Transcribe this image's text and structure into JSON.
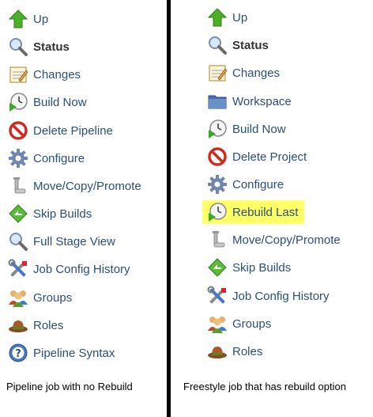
{
  "left_panel": {
    "items": [
      {
        "label": "Up",
        "icon": "up-arrow-icon",
        "bold": false
      },
      {
        "label": "Status",
        "icon": "magnifier-icon",
        "bold": true
      },
      {
        "label": "Changes",
        "icon": "notepad-icon",
        "bold": false
      },
      {
        "label": "Build Now",
        "icon": "clock-play-icon",
        "bold": false
      },
      {
        "label": "Delete Pipeline",
        "icon": "no-entry-icon",
        "bold": false
      },
      {
        "label": "Configure",
        "icon": "gear-icon",
        "bold": false
      },
      {
        "label": "Move/Copy/Promote",
        "icon": "pipe-icon",
        "bold": false
      },
      {
        "label": "Skip Builds",
        "icon": "skip-diamond-icon",
        "bold": false
      },
      {
        "label": "Full Stage View",
        "icon": "magnifier-icon",
        "bold": false
      },
      {
        "label": "Job Config History",
        "icon": "tools-icon",
        "bold": false
      },
      {
        "label": "Groups",
        "icon": "group-icon",
        "bold": false
      },
      {
        "label": "Roles",
        "icon": "hat-icon",
        "bold": false
      },
      {
        "label": "Pipeline Syntax",
        "icon": "help-icon",
        "bold": false
      }
    ],
    "caption": "Pipeline job with no Rebuild"
  },
  "right_panel": {
    "items": [
      {
        "label": "Up",
        "icon": "up-arrow-icon",
        "bold": false
      },
      {
        "label": "Status",
        "icon": "magnifier-icon",
        "bold": true
      },
      {
        "label": "Changes",
        "icon": "notepad-icon",
        "bold": false
      },
      {
        "label": "Workspace",
        "icon": "folder-icon",
        "bold": false
      },
      {
        "label": "Build Now",
        "icon": "clock-play-icon",
        "bold": false
      },
      {
        "label": "Delete Project",
        "icon": "no-entry-icon",
        "bold": false
      },
      {
        "label": "Configure",
        "icon": "gear-icon",
        "bold": false
      },
      {
        "label": "Rebuild Last",
        "icon": "clock-play-icon",
        "bold": false,
        "highlighted": true
      },
      {
        "label": "Move/Copy/Promote",
        "icon": "pipe-icon",
        "bold": false
      },
      {
        "label": "Skip Builds",
        "icon": "skip-diamond-icon",
        "bold": false
      },
      {
        "label": "Job Config History",
        "icon": "tools-icon",
        "bold": false
      },
      {
        "label": "Groups",
        "icon": "group-icon",
        "bold": false
      },
      {
        "label": "Roles",
        "icon": "hat-icon",
        "bold": false
      }
    ],
    "caption": "Freestyle job that has rebuild option"
  },
  "colors": {
    "link": "#2a4f7f",
    "highlight": "#ffff66",
    "divider": "#000000"
  }
}
